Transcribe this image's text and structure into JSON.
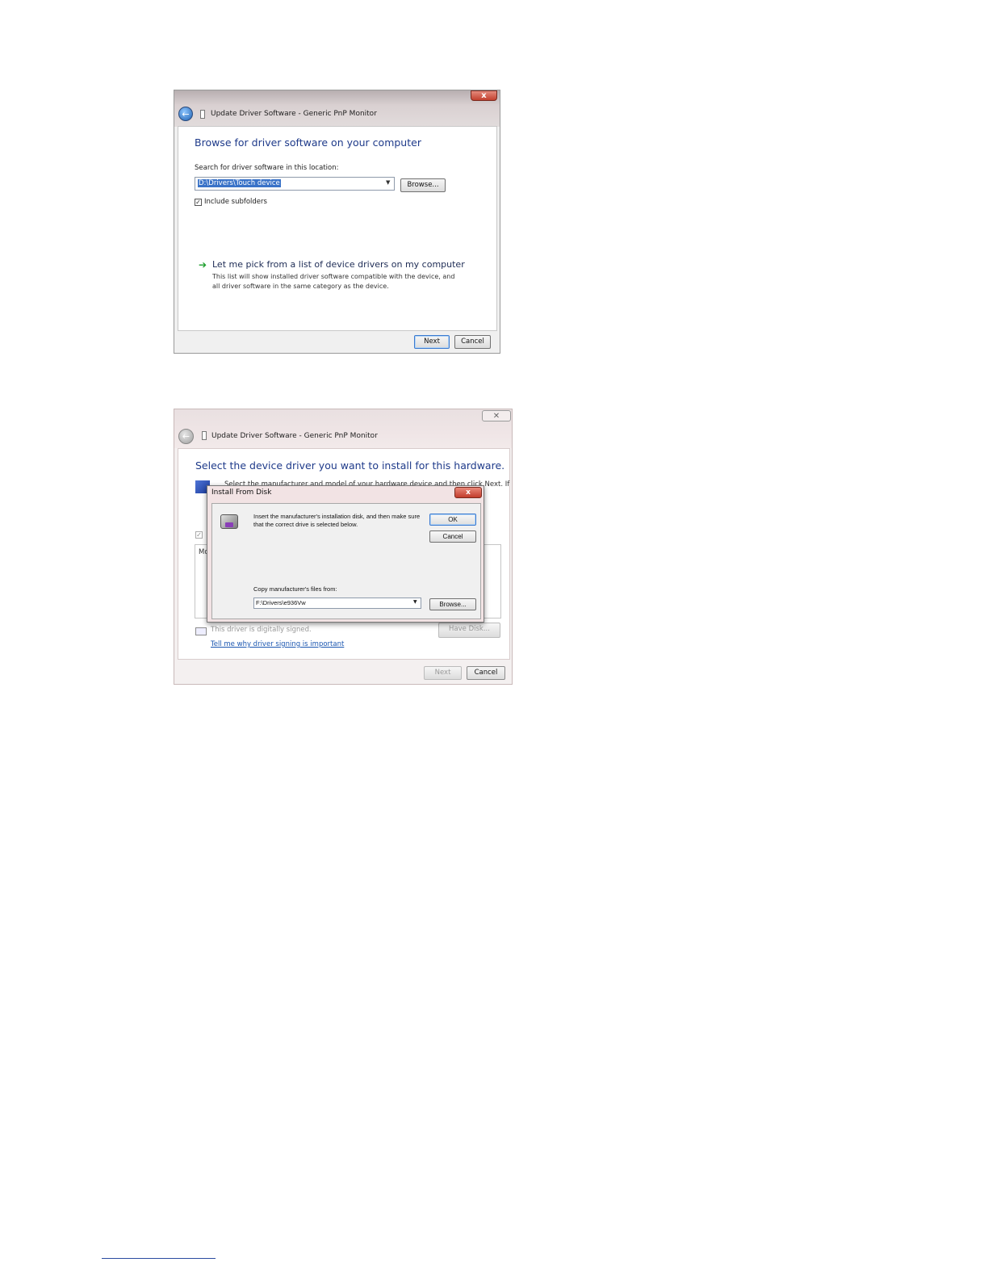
{
  "shot1": {
    "window_title": "Update Driver Software - Generic PnP Monitor",
    "close_glyph": "x",
    "back_glyph": "←",
    "heading": "Browse for driver software on your computer",
    "search_label": "Search for driver software in this location:",
    "path_value": "D:\\Drivers\\Touch device",
    "combo_arrow": "▼",
    "browse_label": "Browse...",
    "include_subfolders_checked": true,
    "check_glyph": "✓",
    "include_subfolders_label": "Include subfolders",
    "pick_arrow": "➔",
    "pick_title": "Let me pick from a list of device drivers on my computer",
    "pick_desc": "This list will show installed driver software compatible with the device, and all driver software in the same category as the device.",
    "next_label": "Next",
    "cancel_label": "Cancel"
  },
  "shot2": {
    "window_title": "Update Driver Software - Generic PnP Monitor",
    "close_glyph": "✕",
    "back_glyph": "←",
    "heading": "Select the device driver you want to install for this hardware.",
    "instruction": "Select the manufacturer and model of your hardware device and then click Next. If you",
    "list_header": "Mo",
    "compat_glyph": "✓",
    "signed_text": "This driver is digitally signed.",
    "signing_link": "Tell me why driver signing is important",
    "have_disk_label": "Have Disk...",
    "next_label": "Next",
    "cancel_label": "Cancel",
    "dialog": {
      "title": "Install From Disk",
      "close_glyph": "x",
      "message": "Insert the manufacturer's installation disk, and then make sure that the correct drive is selected below.",
      "ok_label": "OK",
      "cancel_label": "Cancel",
      "copy_label": "Copy manufacturer's files from:",
      "path_value": "F:\\Drivers\\e936Vw",
      "combo_arrow": "▼",
      "browse_label": "Browse..."
    }
  }
}
